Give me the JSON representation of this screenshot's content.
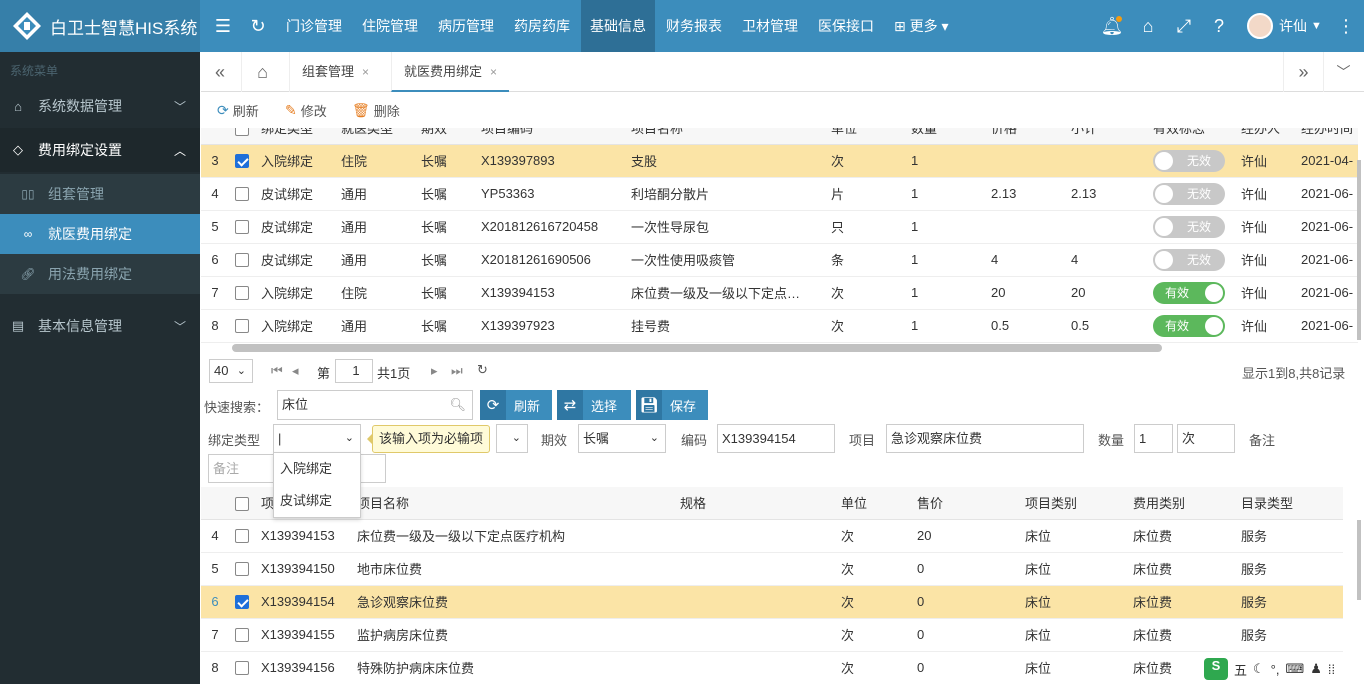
{
  "app": {
    "title": "白卫士智慧HIS系统",
    "user": "许仙",
    "more_label": "更多"
  },
  "topmenu": [
    "门诊管理",
    "住院管理",
    "病历管理",
    "药房药库",
    "基础信息",
    "财务报表",
    "卫材管理",
    "医保接口"
  ],
  "active_topmenu": "基础信息",
  "sidebar": {
    "header": "系统菜单",
    "items": [
      {
        "label": "系统数据管理",
        "icon": "home-icon"
      },
      {
        "label": "费用绑定设置",
        "icon": "diamond-icon"
      },
      {
        "label": "基本信息管理",
        "icon": "document-icon"
      }
    ],
    "subitems": [
      {
        "label": "组套管理",
        "icon": "columns-icon"
      },
      {
        "label": "就医费用绑定",
        "icon": "infinity-icon"
      },
      {
        "label": "用法费用绑定",
        "icon": "link-icon"
      }
    ]
  },
  "tabs": [
    {
      "label": "组套管理"
    },
    {
      "label": "就医费用绑定"
    }
  ],
  "toolbar": {
    "refresh": "刷新",
    "edit": "修改",
    "delete": "删除"
  },
  "upper_table": {
    "headers": [
      "绑定类型",
      "就医类型",
      "期效",
      "项目编码",
      "项目名称",
      "单位",
      "数量",
      "价格",
      "小计",
      "有效标志",
      "经办人",
      "经办时间"
    ],
    "rows": [
      {
        "n": "3",
        "checked": true,
        "selected": true,
        "type": "入院绑定",
        "visit": "住院",
        "period": "长嘱",
        "code": "X139397893",
        "name": "支股",
        "unit": "次",
        "qty": "1",
        "price": "",
        "sub": "",
        "valid": "无效",
        "valid_on": false,
        "agent": "许仙",
        "time": "2021-04-"
      },
      {
        "n": "4",
        "checked": false,
        "selected": false,
        "type": "皮试绑定",
        "visit": "通用",
        "period": "长嘱",
        "code": "YP53363",
        "name": "利培酮分散片",
        "unit": "片",
        "qty": "1",
        "price": "2.13",
        "sub": "2.13",
        "valid": "无效",
        "valid_on": false,
        "agent": "许仙",
        "time": "2021-06-"
      },
      {
        "n": "5",
        "checked": false,
        "selected": false,
        "type": "皮试绑定",
        "visit": "通用",
        "period": "长嘱",
        "code": "X201812616720458",
        "name": "一次性导尿包",
        "unit": "只",
        "qty": "1",
        "price": "",
        "sub": "",
        "valid": "无效",
        "valid_on": false,
        "agent": "许仙",
        "time": "2021-06-"
      },
      {
        "n": "6",
        "checked": false,
        "selected": false,
        "type": "皮试绑定",
        "visit": "通用",
        "period": "长嘱",
        "code": "X20181261690506",
        "name": "一次性使用吸痰管",
        "unit": "条",
        "qty": "1",
        "price": "4",
        "sub": "4",
        "valid": "无效",
        "valid_on": false,
        "agent": "许仙",
        "time": "2021-06-"
      },
      {
        "n": "7",
        "checked": false,
        "selected": false,
        "type": "入院绑定",
        "visit": "住院",
        "period": "长嘱",
        "code": "X139394153",
        "name": "床位费一级及一级以下定点…",
        "unit": "次",
        "qty": "1",
        "price": "20",
        "sub": "20",
        "valid": "有效",
        "valid_on": true,
        "agent": "许仙",
        "time": "2021-06-"
      },
      {
        "n": "8",
        "checked": false,
        "selected": false,
        "type": "入院绑定",
        "visit": "通用",
        "period": "长嘱",
        "code": "X139397923",
        "name": "挂号费",
        "unit": "次",
        "qty": "1",
        "price": "0.5",
        "sub": "0.5",
        "valid": "有效",
        "valid_on": true,
        "agent": "许仙",
        "time": "2021-06-"
      }
    ]
  },
  "pager": {
    "page_size": "40",
    "page_prefix": "第",
    "page": "1",
    "page_suffix": "共1页",
    "summary": "显示1到8,共8记录"
  },
  "search": {
    "label": "快速搜索：",
    "value": "床位",
    "refresh": "刷新",
    "select": "选择",
    "save": "保存"
  },
  "form": {
    "bind_type_label": "绑定类型",
    "bind_type_value": "|",
    "tooltip": "该输入项为必输项",
    "period_label": "期效",
    "period_value": "长嘱",
    "code_label": "编码",
    "code_value": "X139394154",
    "item_label": "项目",
    "item_value": "急诊观察床位费",
    "qty_label": "数量",
    "qty_value": "1",
    "unit_value": "次",
    "remark_label": "备注",
    "remark_placeholder": "备注",
    "dropdown_options": [
      "入院绑定",
      "皮试绑定"
    ]
  },
  "lower_table": {
    "headers": [
      "项",
      "项目名称",
      "规格",
      "单位",
      "售价",
      "项目类别",
      "费用类别",
      "目录类型"
    ],
    "rows": [
      {
        "n": "4",
        "checked": false,
        "selected": false,
        "code": "X139394153",
        "name": "床位费一级及一级以下定点医疗机构",
        "spec": "",
        "unit": "次",
        "price": "20",
        "cat": "床位",
        "fee": "床位费",
        "dir": "服务"
      },
      {
        "n": "5",
        "checked": false,
        "selected": false,
        "code": "X139394150",
        "name": "地市床位费",
        "spec": "",
        "unit": "次",
        "price": "0",
        "cat": "床位",
        "fee": "床位费",
        "dir": "服务"
      },
      {
        "n": "6",
        "checked": true,
        "selected": true,
        "code": "X139394154",
        "name": "急诊观察床位费",
        "spec": "",
        "unit": "次",
        "price": "0",
        "cat": "床位",
        "fee": "床位费",
        "dir": "服务"
      },
      {
        "n": "7",
        "checked": false,
        "selected": false,
        "code": "X139394155",
        "name": "监护病房床位费",
        "spec": "",
        "unit": "次",
        "price": "0",
        "cat": "床位",
        "fee": "床位费",
        "dir": "服务"
      },
      {
        "n": "8",
        "checked": false,
        "selected": false,
        "code": "X139394156",
        "name": "特殊防护病床床位费",
        "spec": "",
        "unit": "次",
        "price": "0",
        "cat": "床位",
        "fee": "床位费",
        "dir": ""
      }
    ]
  },
  "ime": {
    "label": "五"
  },
  "colors": {
    "topbar": "#3c8dbc",
    "sidebar": "#222d32",
    "selected_row": "#fbe4a6",
    "switch_on": "#5cb85c"
  }
}
